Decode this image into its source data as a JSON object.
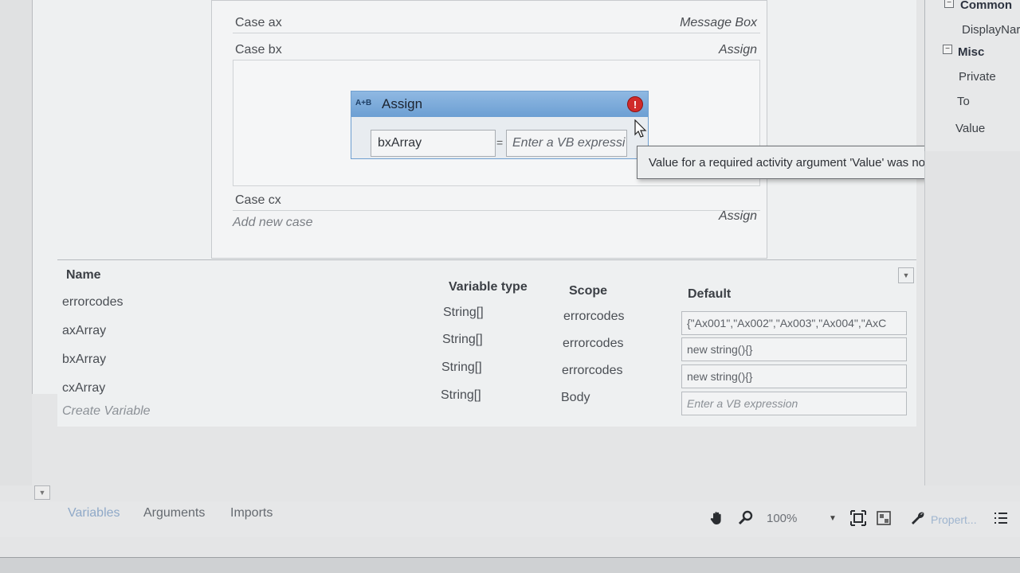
{
  "switch": {
    "cases": [
      {
        "label": "Case  ax",
        "action": "Message Box"
      },
      {
        "label": "Case  bx",
        "action": "Assign"
      },
      {
        "label": "Case  cx",
        "action": "Assign"
      }
    ],
    "add_new_case": "Add new case"
  },
  "assign": {
    "glyph": "A+B",
    "title": "Assign",
    "to_value": "bxArray",
    "equals": "=",
    "value_placeholder": "Enter a VB expressi",
    "error_icon": "error-icon"
  },
  "tooltip": {
    "text": "Value for a required activity argument 'Value' was not supplied."
  },
  "variables": {
    "headers": {
      "name": "Name",
      "type": "Variable type",
      "scope": "Scope",
      "default": "Default"
    },
    "rows": [
      {
        "name": "errorcodes",
        "type": "String[]",
        "scope": "errorcodes",
        "default": "{\"Ax001\",\"Ax002\",\"Ax003\",\"Ax004\",\"AxC"
      },
      {
        "name": "axArray",
        "type": "String[]",
        "scope": "errorcodes",
        "default": "new string(){}"
      },
      {
        "name": "bxArray",
        "type": "String[]",
        "scope": "errorcodes",
        "default": "new string(){}"
      },
      {
        "name": "cxArray",
        "type": "String[]",
        "scope": "Body",
        "default": "Enter a VB expression"
      }
    ],
    "create_variable": "Create Variable"
  },
  "properties": {
    "categories": [
      {
        "name": "Common",
        "items": [
          "DisplayNar"
        ]
      },
      {
        "name": "Misc",
        "items": [
          "Private",
          "To",
          "Value"
        ]
      }
    ]
  },
  "bottom": {
    "tabs": [
      "Variables",
      "Arguments",
      "Imports"
    ],
    "zoom": "100%",
    "properties_tab": "Propert..."
  }
}
